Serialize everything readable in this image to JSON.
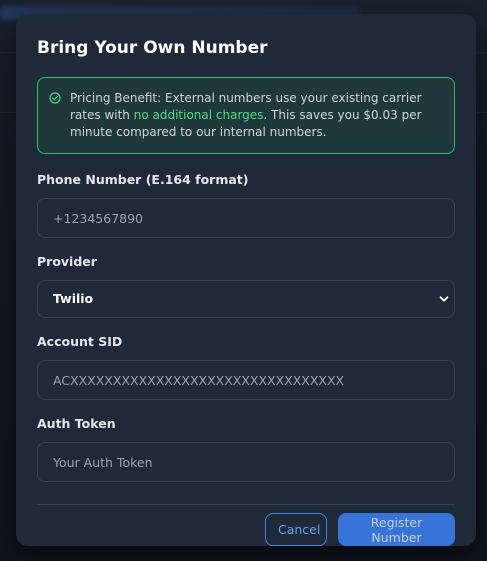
{
  "modal": {
    "title": "Bring Your Own Number",
    "info": {
      "prefix": "Pricing Benefit: External numbers use your existing carrier rates with ",
      "highlight": "no additional charges",
      "suffix": ". This saves you $0.03 per minute compared to our internal numbers.",
      "icon": "check-circle-icon",
      "color": "#22c55e"
    },
    "fields": {
      "phone": {
        "label": "Phone Number (E.164 format)",
        "value": "",
        "placeholder": "+1234567890"
      },
      "provider": {
        "label": "Provider",
        "selected": "Twilio",
        "icon": "chevron-down-icon"
      },
      "account_sid": {
        "label": "Account SID",
        "value": "",
        "placeholder": "ACXXXXXXXXXXXXXXXXXXXXXXXXXXXXXXXX"
      },
      "auth_token": {
        "label": "Auth Token",
        "value": "",
        "placeholder": "Your Auth Token"
      }
    },
    "buttons": {
      "cancel": "Cancel",
      "submit": "Register Number"
    },
    "colors": {
      "accent": "#3b82f6",
      "background": "#1f2937",
      "success": "#22c55e"
    }
  }
}
